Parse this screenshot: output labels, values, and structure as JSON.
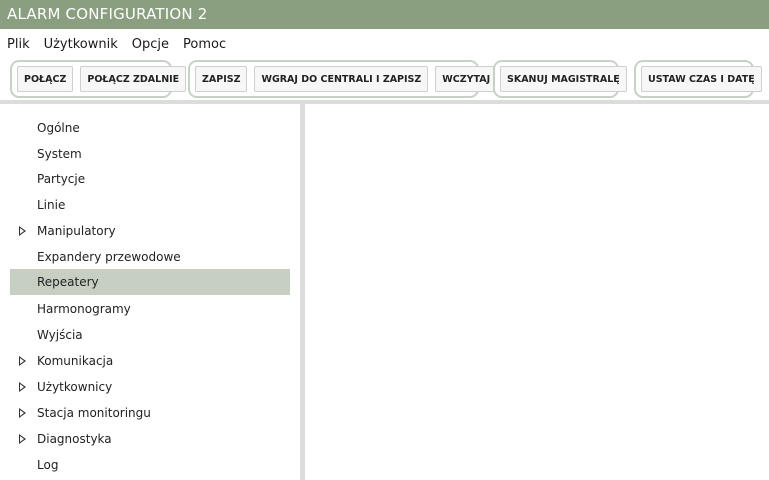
{
  "window": {
    "title": "ALARM CONFIGURATION 2"
  },
  "menu": {
    "items": [
      "Plik",
      "Użytkownik",
      "Opcje",
      "Pomoc"
    ]
  },
  "toolbar": {
    "polacz": "POŁĄCZ",
    "polacz_zdalnie": "POŁĄCZ ZDALNIE",
    "zapisz": "ZAPISZ",
    "wgraj": "WGRAJ DO CENTRALI I ZAPISZ",
    "wczytaj": "WCZYTAJ",
    "skanuj": "SKANUJ MAGISTRALĘ",
    "ustaw_czas": "USTAW CZAS I DATĘ"
  },
  "sidebar": {
    "items": [
      {
        "label": "Ogólne",
        "expandable": false
      },
      {
        "label": "System",
        "expandable": false
      },
      {
        "label": "Partycje",
        "expandable": false
      },
      {
        "label": "Linie",
        "expandable": false
      },
      {
        "label": "Manipulatory",
        "expandable": true
      },
      {
        "label": "Expandery przewodowe",
        "expandable": false
      },
      {
        "label": "Repeatery",
        "expandable": false,
        "selected": true
      },
      {
        "label": "Harmonogramy",
        "expandable": false
      },
      {
        "label": "Wyjścia",
        "expandable": false
      },
      {
        "label": "Komunikacja",
        "expandable": true
      },
      {
        "label": "Użytkownicy",
        "expandable": true
      },
      {
        "label": "Stacja monitoringu",
        "expandable": true
      },
      {
        "label": "Diagnostyka",
        "expandable": true
      },
      {
        "label": "Log",
        "expandable": false
      }
    ]
  },
  "colors": {
    "titlebar": "#8a9e80",
    "selected_item": "#c6cfc2",
    "group_border": "#c7d2c7"
  }
}
